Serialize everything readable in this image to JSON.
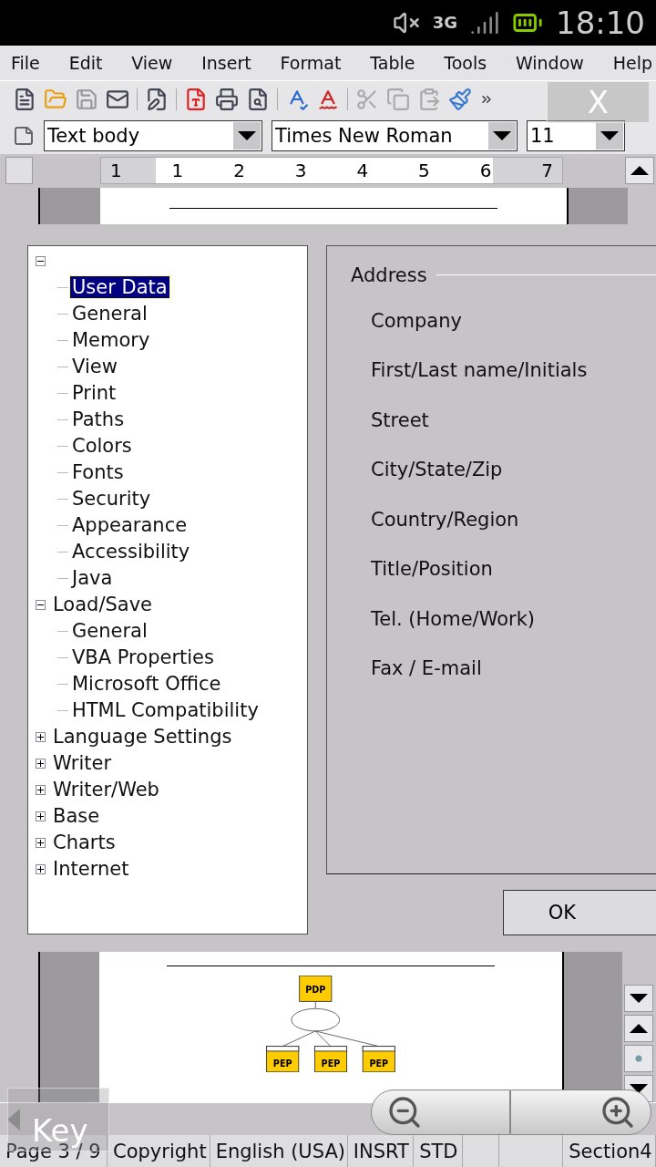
{
  "phone_status": {
    "network": "3G",
    "time": "18:10"
  },
  "menu": [
    "File",
    "Edit",
    "View",
    "Insert",
    "Format",
    "Table",
    "Tools",
    "Window",
    "Help"
  ],
  "format_bar": {
    "style": "Text body",
    "font": "Times New Roman",
    "size": "11"
  },
  "ruler": [
    "1",
    "1",
    "2",
    "3",
    "4",
    "5",
    "6",
    "7"
  ],
  "close_overlay": "X",
  "options_tree": [
    {
      "expanded": true,
      "children": [
        {
          "label": "User Data",
          "selected": true
        },
        {
          "label": "General",
          "selected": false
        },
        {
          "label": "Memory",
          "selected": false
        },
        {
          "label": "View",
          "selected": false
        },
        {
          "label": "Print",
          "selected": false
        },
        {
          "label": "Paths",
          "selected": false
        },
        {
          "label": "Colors",
          "selected": false
        },
        {
          "label": "Fonts",
          "selected": false
        },
        {
          "label": "Security",
          "selected": false
        },
        {
          "label": "Appearance",
          "selected": false
        },
        {
          "label": "Accessibility",
          "selected": false
        },
        {
          "label": "Java",
          "selected": false
        }
      ]
    },
    {
      "label": "Load/Save",
      "expanded": true,
      "children": [
        {
          "label": "General",
          "selected": false
        },
        {
          "label": "VBA Properties",
          "selected": false
        },
        {
          "label": "Microsoft Office",
          "selected": false
        },
        {
          "label": "HTML Compatibility",
          "selected": false
        }
      ]
    },
    {
      "label": "Language Settings",
      "expanded": false
    },
    {
      "label": "Writer",
      "expanded": false
    },
    {
      "label": "Writer/Web",
      "expanded": false
    },
    {
      "label": "Base",
      "expanded": false
    },
    {
      "label": "Charts",
      "expanded": false
    },
    {
      "label": "Internet",
      "expanded": false
    }
  ],
  "address": {
    "title": "Address",
    "fields": [
      "Company",
      "First/Last name/Initials",
      "Street",
      "City/State/Zip",
      "Country/Region",
      "Title/Position",
      "Tel. (Home/Work)",
      "Fax / E-mail"
    ]
  },
  "ok_button": "OK",
  "diagram": {
    "top": "PDP",
    "bottom": [
      "PEP",
      "PEP",
      "PEP"
    ]
  },
  "key_overlay": "Key",
  "status_bar": [
    "Page 3 / 9",
    "Copyright",
    "English (USA)",
    "INSRT",
    "STD",
    "Section4"
  ]
}
